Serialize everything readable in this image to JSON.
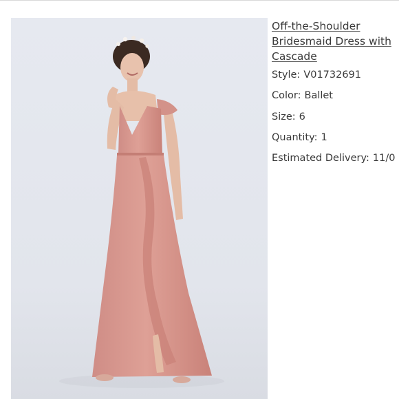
{
  "product": {
    "image_alt": "Model wearing a blush pink off-the-shoulder bridesmaid dress",
    "title": "Off-the-Shoulder Bridesmaid Dress with Cascade",
    "style_label": "Style:",
    "style_value": "V01732691",
    "color_label": "Color:",
    "color_value": "Ballet",
    "size_label": "Size:",
    "size_value": "6",
    "quantity_label": "Quantity:",
    "quantity_value": "1",
    "delivery_label": "Estimated Delivery:",
    "delivery_value": "11/0"
  },
  "colors": {
    "dress": "#d99a92",
    "background": "#e3e6ed",
    "text": "#3a3a3a"
  }
}
